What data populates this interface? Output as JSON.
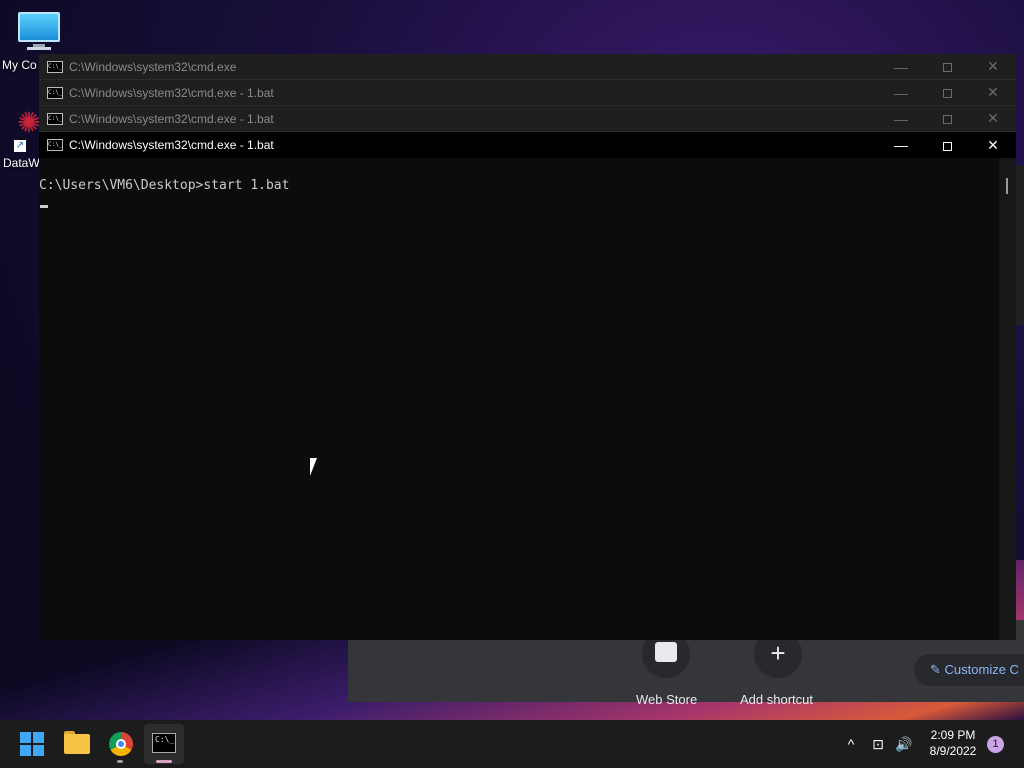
{
  "desktop": {
    "icons": [
      {
        "label": "My Co"
      },
      {
        "label": "DataW"
      }
    ]
  },
  "chrome_background": {
    "tiles": [
      {
        "label": "Web Store"
      },
      {
        "label": "Add shortcut",
        "glyph": "+"
      }
    ],
    "customize_label": "Customize C"
  },
  "cmd_windows": [
    {
      "title": "C:\\Windows\\system32\\cmd.exe",
      "state": "inactive"
    },
    {
      "title": "C:\\Windows\\system32\\cmd.exe - 1.bat",
      "state": "inactive"
    },
    {
      "title": "C:\\Windows\\system32\\cmd.exe - 1.bat",
      "state": "inactive"
    },
    {
      "title": "C:\\Windows\\system32\\cmd.exe - 1.bat",
      "state": "active"
    }
  ],
  "window_controls": {
    "minimize": "—",
    "close": "✕"
  },
  "cmd_icon_text": "C:\\_",
  "console": {
    "line1": "C:\\Users\\VM6\\Desktop>start 1.bat"
  },
  "taskbar": {
    "apps": [
      "start",
      "file-explorer",
      "chrome",
      "command-prompt"
    ],
    "tray": {
      "chevron": "^",
      "network": "⊡",
      "volume": "🔊"
    },
    "clock": {
      "time": "2:09 PM",
      "date": "8/9/2022"
    },
    "notification_count": "1"
  },
  "colors": {
    "accent": "#3fa9f5",
    "chrome_running": "#a0a0a0",
    "cmd_running": "#d9a2c5"
  }
}
